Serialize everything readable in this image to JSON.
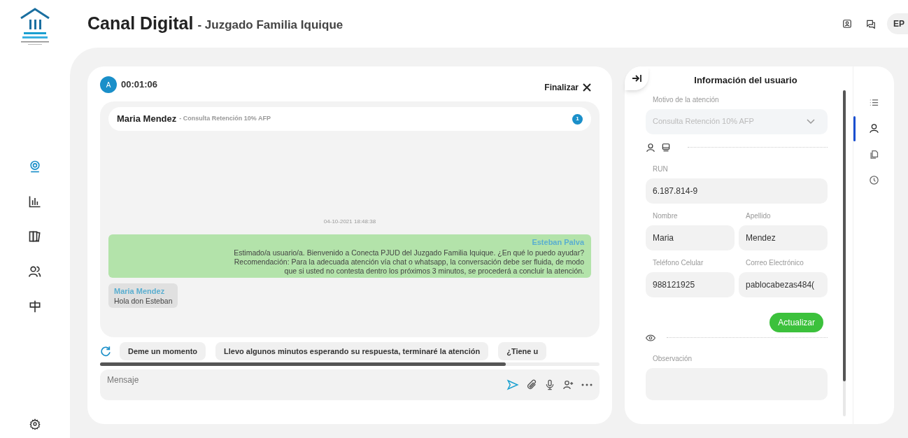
{
  "header": {
    "title": "Canal Digital",
    "subtitle": "- Juzgado Familia Iquique",
    "avatar": "EP"
  },
  "sidebar": {
    "items": [
      {
        "selected": true
      },
      {
        "selected": false
      },
      {
        "selected": false
      },
      {
        "selected": false
      },
      {
        "selected": false
      }
    ]
  },
  "chat": {
    "agent_avatar": "A",
    "timer": "00:01:06",
    "end_button": "Finalizar",
    "conversation": {
      "name": "Maria Mendez",
      "topic": "- Consulta Retención 10% AFP",
      "unread": "1"
    },
    "timestamp": "04-10-2021 18:48:38",
    "messages": [
      {
        "kind": "outgoing",
        "author": "Esteban Palva",
        "text": "Estimado/a usuario/a. Bienvenido a Conecta PJUD del Juzgado Familia Iquique. ¿En qué lo puedo ayudar?\nRecomendación: Para la adecuada atención vía chat o whatsapp, la conversación debe ser fluida, de modo\nque si usted no contesta dentro los próximos 3 minutos, se procederá a concluir la atención."
      },
      {
        "kind": "incoming",
        "author": "Maria Mendez",
        "text": "Hola don Esteban"
      }
    ],
    "quick_replies": [
      "Deme un momento",
      "Llevo algunos minutos esperando su respuesta, terminaré la atención",
      "¿Tiene u"
    ],
    "input": {
      "placeholder": "Mensaje"
    }
  },
  "user_panel": {
    "title": "Información del usuario",
    "reason": {
      "label": "Motivo de la atención",
      "value": "Consulta Retención 10% AFP",
      "disabled": true
    },
    "fields": [
      {
        "label": "RUN",
        "value": "6.187.814-9",
        "wide": true
      },
      {
        "label": "Nombre",
        "value": "Maria",
        "wide": false
      },
      {
        "label": "Apellido",
        "value": "Mendez",
        "wide": false
      },
      {
        "label": "Teléfono Celular",
        "value": "988121925",
        "wide": false
      },
      {
        "label": "Correo Electrónico",
        "value": "pablocabezas484(",
        "wide": false
      }
    ],
    "update_button": "Actualizar",
    "observation": {
      "label": "Observación"
    }
  },
  "rail": {
    "items": [
      {
        "selected": false
      },
      {
        "selected": true
      },
      {
        "selected": false
      },
      {
        "selected": false
      }
    ]
  }
}
